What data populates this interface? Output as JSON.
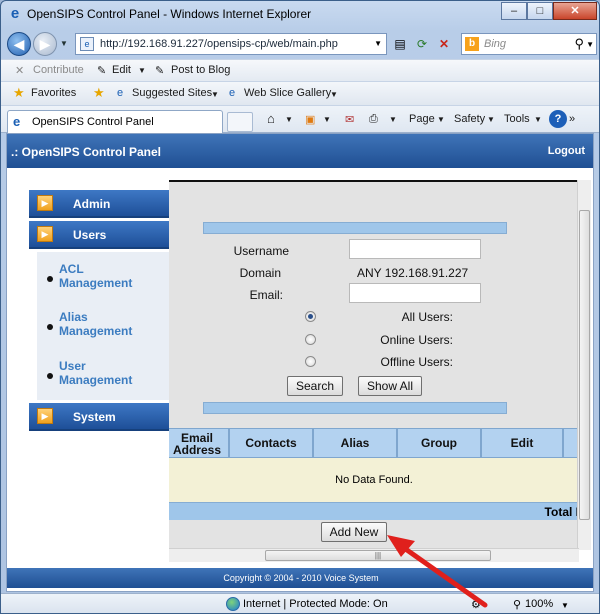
{
  "window": {
    "title": "OpenSIPS Control Panel - Windows Internet Explorer",
    "controls": {
      "minimize": "–",
      "maximize": "□",
      "close": "✕"
    }
  },
  "navbar": {
    "address": "http://192.168.91.227/opensips-cp/web/main.php",
    "search_placeholder": "Bing"
  },
  "toolbar": {
    "contribute": "Contribute",
    "edit": "Edit",
    "post_to_blog": "Post to Blog"
  },
  "favorites_bar": {
    "favorites": "Favorites",
    "suggested_sites": "Suggested Sites",
    "web_slice_gallery": "Web Slice Gallery"
  },
  "tab": {
    "title": "OpenSIPS Control Panel"
  },
  "command_bar": {
    "page": "Page",
    "safety": "Safety",
    "tools": "Tools"
  },
  "page": {
    "brand": ".: OpenSIPS Control Panel",
    "logout": "Logout",
    "sidebar": {
      "admin": "Admin",
      "users": "Users",
      "sub": {
        "acl": [
          "ACL",
          "Management"
        ],
        "alias": [
          "Alias",
          "Management"
        ],
        "user": [
          "User",
          "Management"
        ]
      },
      "system": "System"
    },
    "form": {
      "username_label": "Username",
      "domain_label": "Domain",
      "domain_value": "ANY 192.168.91.227",
      "email_label": "Email:",
      "radio_all": "All Users:",
      "radio_online": "Online Users:",
      "radio_offline": "Offline Users:",
      "search_btn": "Search",
      "show_all_btn": "Show All"
    },
    "table": {
      "headers": [
        "Email Address",
        "Contacts",
        "Alias",
        "Group",
        "Edit"
      ],
      "no_data": "No Data Found.",
      "total": "Total I"
    },
    "add_new": "Add New",
    "footer": "Copyright © 2004 - 2010 Voice System"
  },
  "statusbar": {
    "zone": "Internet | Protected Mode: On",
    "zoom": "100%"
  },
  "colors": {
    "header": "#1f4f93",
    "accent_bar": "#9fc6ea",
    "arrow": "#e0201c"
  }
}
